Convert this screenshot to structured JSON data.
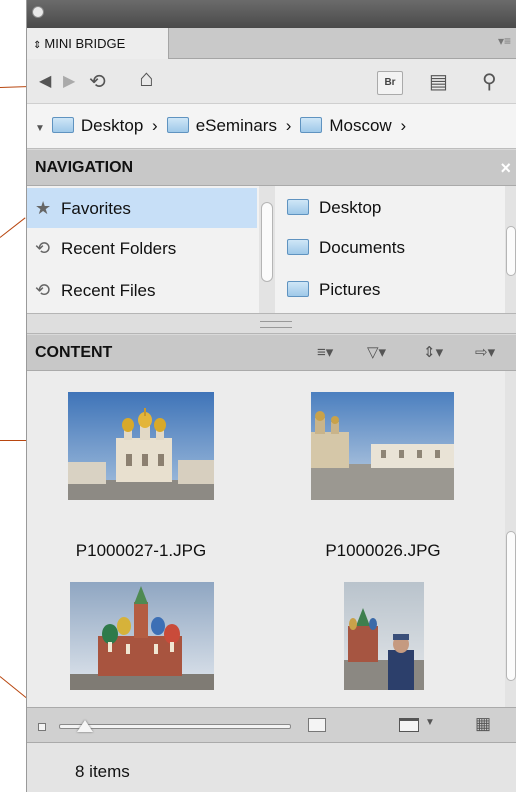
{
  "panel": {
    "tab_label": "MINI BRIDGE",
    "tab_arrow": "⇕",
    "menu_glyph": "▾≡"
  },
  "toolbar": {
    "back_icon": "◀",
    "forward_icon": "▶",
    "recent_icon": "⟲",
    "home_icon": "⌂",
    "bridge_label": "Br",
    "view_icon": "▤",
    "search_icon": "⚲"
  },
  "path": {
    "expand_glyph": "▼",
    "segments": [
      {
        "label": "Desktop",
        "sep": "›"
      },
      {
        "label": "eSeminars",
        "sep": "›"
      },
      {
        "label": "Moscow",
        "sep": "›"
      }
    ]
  },
  "navigation": {
    "title": "NAVIGATION",
    "close_glyph": "×",
    "items": [
      {
        "label": "Favorites",
        "icon": "star-icon",
        "glyph": "★"
      },
      {
        "label": "Recent Folders",
        "icon": "recent-folders-icon",
        "glyph": "⟲"
      },
      {
        "label": "Recent Files",
        "icon": "recent-files-icon",
        "glyph": "⟲"
      }
    ],
    "folders": [
      {
        "label": "Desktop"
      },
      {
        "label": "Documents"
      },
      {
        "label": "Pictures"
      }
    ]
  },
  "content": {
    "title": "CONTENT",
    "tools": {
      "sort": "≡▾",
      "filter": "▽▾",
      "order": "⇕▾",
      "tools": "⇨▾"
    },
    "files": [
      {
        "name": "P1000027-1.JPG"
      },
      {
        "name": "P1000026.JPG"
      },
      {
        "name": ""
      },
      {
        "name": ""
      }
    ]
  },
  "status": {
    "items_count": "8 items"
  },
  "colors": {
    "selection": "#c7dff7",
    "callout": "#b8460f"
  }
}
